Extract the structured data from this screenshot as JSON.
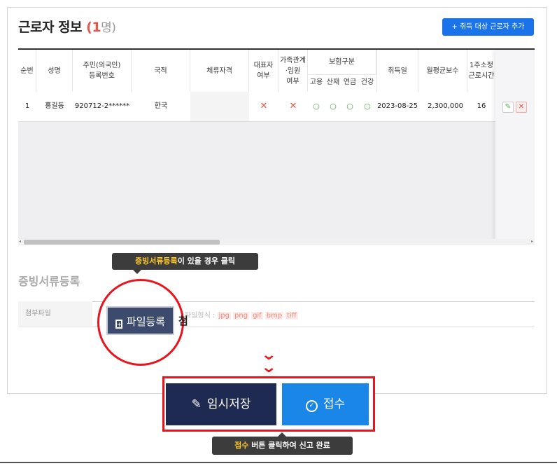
{
  "header": {
    "title": "근로자 정보",
    "count_open": "(",
    "count": "1",
    "count_unit": "명)",
    "add_button": "+ 취득 대상 근로자 추가"
  },
  "table": {
    "headers": {
      "seq": "순번",
      "name": "성명",
      "rrn_line1": "주민(외국인)",
      "rrn_line2": "등록번호",
      "nation": "국적",
      "visa": "체류자격",
      "rep_line1": "대표자",
      "rep_line2": "여부",
      "fam_line1": "가족관계",
      "fam_line2": "·임원",
      "fam_line3": "여부",
      "insurance_group": "보험구분",
      "ins_emp": "고용",
      "ins_ind": "산재",
      "ins_pen": "연금",
      "ins_hlt": "건강",
      "acq_date": "취득일",
      "salary": "월평균보수",
      "hours_line1": "1주소정",
      "hours_line2": "근로시간"
    },
    "rows": [
      {
        "seq": "1",
        "name": "홍길동",
        "rrn": "920712-2******",
        "nation": "한국",
        "visa": "",
        "rep": "✕",
        "fam": "✕",
        "ins_emp": "○",
        "ins_ind": "○",
        "ins_pen": "○",
        "ins_hlt": "○",
        "acq_date": "2023-08-25",
        "salary": "2,300,000",
        "hours": "16"
      }
    ],
    "actions": {
      "edit_icon": "pencil-icon",
      "delete_icon": "close-icon"
    }
  },
  "tooltip_top": {
    "highlight": "증빙서류등록",
    "rest": "이 있을 경우 클릭"
  },
  "evidence": {
    "section_title": "증빙서류등록",
    "attach_label": "첨부파일",
    "file_button": "파일등록",
    "file_button_icon": "file-upload-icon",
    "trailing_text": "첨",
    "format_label": "파일형식 :",
    "formats": [
      "jpg",
      "png",
      "gif",
      "bmp",
      "tiff"
    ]
  },
  "actions": {
    "temp_save_icon": "pencil-icon",
    "temp_save": "임시저장",
    "submit_icon": "check-circle-icon",
    "submit": "접수"
  },
  "tooltip_bottom": {
    "highlight": "접수",
    "rest": " 버튼 클릭하여 신고 완료"
  },
  "colors": {
    "primary": "#1a86e8",
    "dark_navy": "#1f2a52",
    "highlight_red": "#e8141e",
    "tooltip_yellow": "#ffc928"
  }
}
